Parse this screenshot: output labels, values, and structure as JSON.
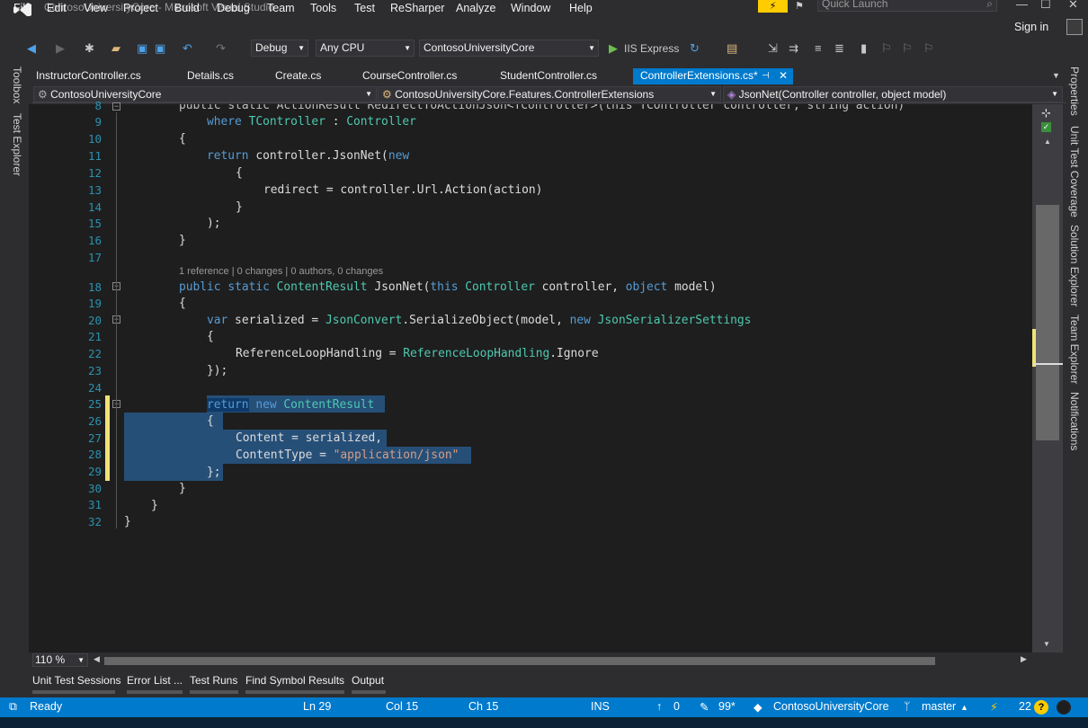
{
  "window": {
    "title": "ContosoUniversityCore - Microsoft Visual Studio",
    "quick_launch_placeholder": "Quick Launch"
  },
  "menu": [
    "File",
    "Edit",
    "View",
    "Project",
    "Build",
    "Debug",
    "Team",
    "Tools",
    "Test",
    "ReSharper",
    "Analyze",
    "Window",
    "Help"
  ],
  "account": {
    "sign_in": "Sign in"
  },
  "toolbar": {
    "configuration": "Debug",
    "platform": "Any CPU",
    "startup_project": "ContosoUniversityCore",
    "run_target": "IIS Express"
  },
  "tabs": [
    {
      "label": "InstructorController.cs"
    },
    {
      "label": "Details.cs"
    },
    {
      "label": "Create.cs"
    },
    {
      "label": "CourseController.cs"
    },
    {
      "label": "StudentController.cs"
    },
    {
      "label": "ControllerExtensions.cs*",
      "active": true
    }
  ],
  "navbar": {
    "project": "ContosoUniversityCore",
    "type": "ContosoUniversityCore.Features.ControllerExtensions",
    "member": "JsonNet(Controller controller, object model)"
  },
  "left_tool_windows": [
    "Toolbox",
    "Test Explorer"
  ],
  "right_tool_windows": [
    "Properties",
    "Unit Test Coverage",
    "Solution Explorer",
    "Team Explorer",
    "Notifications"
  ],
  "code": {
    "line_numbers": [
      "8",
      "9",
      "10",
      "11",
      "12",
      "13",
      "14",
      "15",
      "16",
      "17",
      "18",
      "19",
      "20",
      "21",
      "22",
      "23",
      "24",
      "25",
      "26",
      "27",
      "28",
      "29",
      "30",
      "31",
      "32"
    ],
    "partial_line_8": "public static ActionResult RedirectToActionJson<TController>(this TController controller, string action)",
    "line_9": "where TController : Controller",
    "lens": "1 reference | 0 changes | 0 authors, 0 changes",
    "texts": {
      "brace_open": "{",
      "brace_close": "}",
      "return_json": "return controller.JsonNet(new",
      "redirect": "redirect = controller.Url.Action(action)",
      "close_paren": ");",
      "jsonnet_sig_1": "public static ",
      "jsonnet_sig_2": "ContentResult",
      "jsonnet_sig_3": " JsonNet(",
      "jsonnet_sig_4": "this ",
      "jsonnet_sig_5": "Controller",
      "jsonnet_sig_6": " controller, ",
      "jsonnet_sig_7": "object",
      "jsonnet_sig_8": " model)",
      "var": "var",
      "serialized": " serialized = ",
      "jsonconvert": "JsonConvert",
      "serialize": ".SerializeObject(model, ",
      "new": "new",
      "settings": "JsonSerializerSettings",
      "refloop": "ReferenceLoopHandling = ",
      "refloop_type": "ReferenceLoopHandling",
      "ignore": ".Ignore",
      "close_brace_paren": "});",
      "return": "return",
      "content_result": "ContentResult",
      "content": "Content = serialized,",
      "content_type": "ContentType = ",
      "mime": "\"application/json\"",
      "semi_brace": "};"
    }
  },
  "zoom": "110 %",
  "bottom_tabs": [
    "Unit Test Sessions",
    "Error List ...",
    "Test Runs",
    "Find Symbol Results",
    "Output"
  ],
  "status": {
    "state": "Ready",
    "ln": "Ln 29",
    "col": "Col 15",
    "ch": "Ch 15",
    "mode": "INS",
    "push": "0",
    "pencil": "99*",
    "repo": "ContosoUniversityCore",
    "branch": "master",
    "notifications": "22"
  },
  "colors": {
    "accent": "#007acc",
    "keyword": "#569cd6",
    "type": "#4ec9b0",
    "string": "#d69d85",
    "selection": "#264f78",
    "line_number": "#2b91af"
  }
}
